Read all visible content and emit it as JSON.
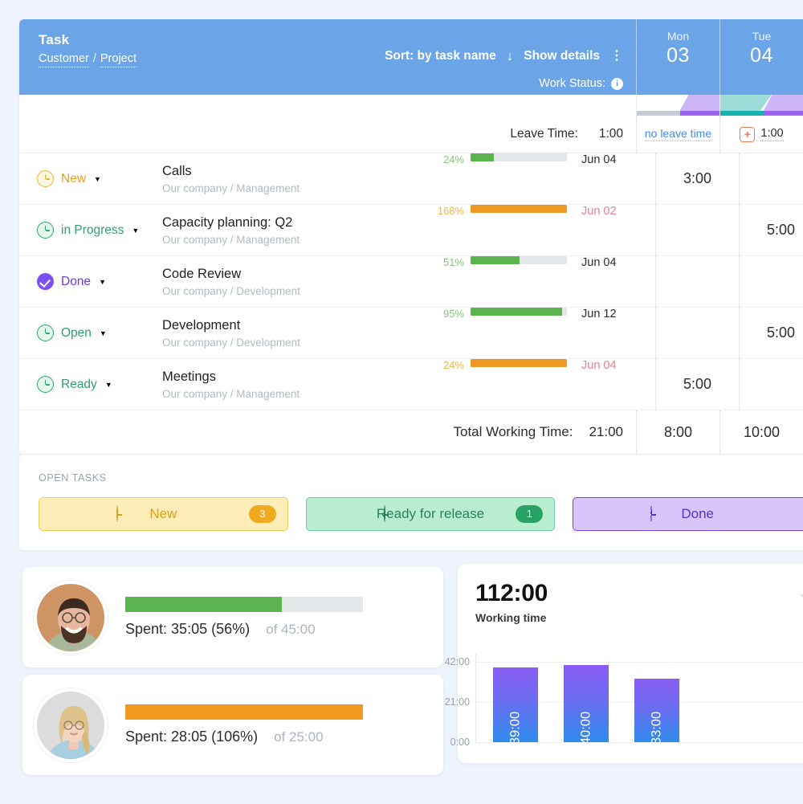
{
  "header": {
    "title": "Task",
    "breadcrumb_customer": "Customer",
    "breadcrumb_separator": "/",
    "breadcrumb_project": "Project",
    "sort_label": "Sort: by task name",
    "sort_arrow": "↓",
    "show_details": "Show details",
    "kebab": "⋮",
    "work_status_label": "Work Status:",
    "info_icon": "i"
  },
  "days": [
    {
      "name": "Mon",
      "number": "03"
    },
    {
      "name": "Tue",
      "number": "04"
    }
  ],
  "leave_row": {
    "label": "Leave Time:",
    "total": "1:00",
    "cells": [
      {
        "type": "link",
        "text": "no leave time"
      },
      {
        "type": "add",
        "plus": "+",
        "value": "1:00"
      }
    ]
  },
  "tasks": [
    {
      "status": {
        "label": "New",
        "icon": "clock-icon",
        "color": "yellow"
      },
      "name": "Calls",
      "path": "Our company / Management",
      "percent": "24%",
      "percent_color": "green",
      "bar_fill": 24,
      "bar_color": "green",
      "date": "Jun 04",
      "date_color": "normal",
      "mon": "3:00",
      "tue": ""
    },
    {
      "status": {
        "label": "in Progress",
        "icon": "clock-icon",
        "color": "green"
      },
      "name": "Capacity planning: Q2",
      "path": "Our company / Management",
      "percent": "168%",
      "percent_color": "orange",
      "bar_fill": 100,
      "bar_color": "orange",
      "date": "Jun 02",
      "date_color": "red",
      "mon": "",
      "tue": "5:00"
    },
    {
      "status": {
        "label": "Done",
        "icon": "check-icon",
        "color": "purple"
      },
      "name": "Code Review",
      "path": "Our company / Development",
      "percent": "51%",
      "percent_color": "green",
      "bar_fill": 51,
      "bar_color": "green",
      "date": "Jun 04",
      "date_color": "normal",
      "mon": "",
      "tue": ""
    },
    {
      "status": {
        "label": "Open",
        "icon": "clock-icon",
        "color": "green"
      },
      "name": "Development",
      "path": "Our company / Development",
      "percent": "95%",
      "percent_color": "green",
      "bar_fill": 95,
      "bar_color": "green",
      "date": "Jun 12",
      "date_color": "normal",
      "mon": "",
      "tue": "5:00"
    },
    {
      "status": {
        "label": "Ready",
        "icon": "clock-icon",
        "color": "green"
      },
      "name": "Meetings",
      "path": "Our company / Management",
      "percent": "24%",
      "percent_color": "orange",
      "bar_fill": 100,
      "bar_color": "orange",
      "date": "Jun 04",
      "date_color": "red",
      "mon": "5:00",
      "tue": ""
    }
  ],
  "totals": {
    "label": "Total Working Time:",
    "value": "21:00",
    "mon": "8:00",
    "tue": "10:00"
  },
  "open_tasks": {
    "label": "OPEN TASKS",
    "chips": [
      {
        "label": "New",
        "count": "3",
        "icon": "clock-icon",
        "style": "new"
      },
      {
        "label": "Ready for release",
        "count": "1",
        "icon": "clock-icon",
        "style": "ready"
      },
      {
        "label": "Done",
        "count": "",
        "icon": "clock-dashed-icon",
        "style": "done"
      }
    ]
  },
  "users": [
    {
      "spent": "Spent: 35:05 (56%)",
      "of": "of 45:00",
      "bar_fill": 66,
      "bar_color": "green",
      "avatar": "male-avatar"
    },
    {
      "spent": "Spent: 28:05 (106%)",
      "of": "of 25:00",
      "bar_fill": 100,
      "bar_color": "orange",
      "avatar": "female-avatar"
    }
  ],
  "chart_data": {
    "type": "bar",
    "title": "112:00",
    "subtitle": "Working time",
    "categories": [
      "",
      "",
      ""
    ],
    "values": [
      39,
      40,
      33
    ],
    "value_labels": [
      "39:00",
      "40:00",
      "33:00"
    ],
    "ylabel": "",
    "xlabel": "",
    "ytick_labels": [
      "42:00",
      "21:00",
      "0:00"
    ],
    "ytick_values": [
      42,
      21,
      0
    ],
    "ylim": [
      0,
      46
    ],
    "grid": true,
    "legend": "none",
    "bar_gradient_top": "#8b5cf6",
    "bar_gradient_bottom": "#2f8ced"
  }
}
